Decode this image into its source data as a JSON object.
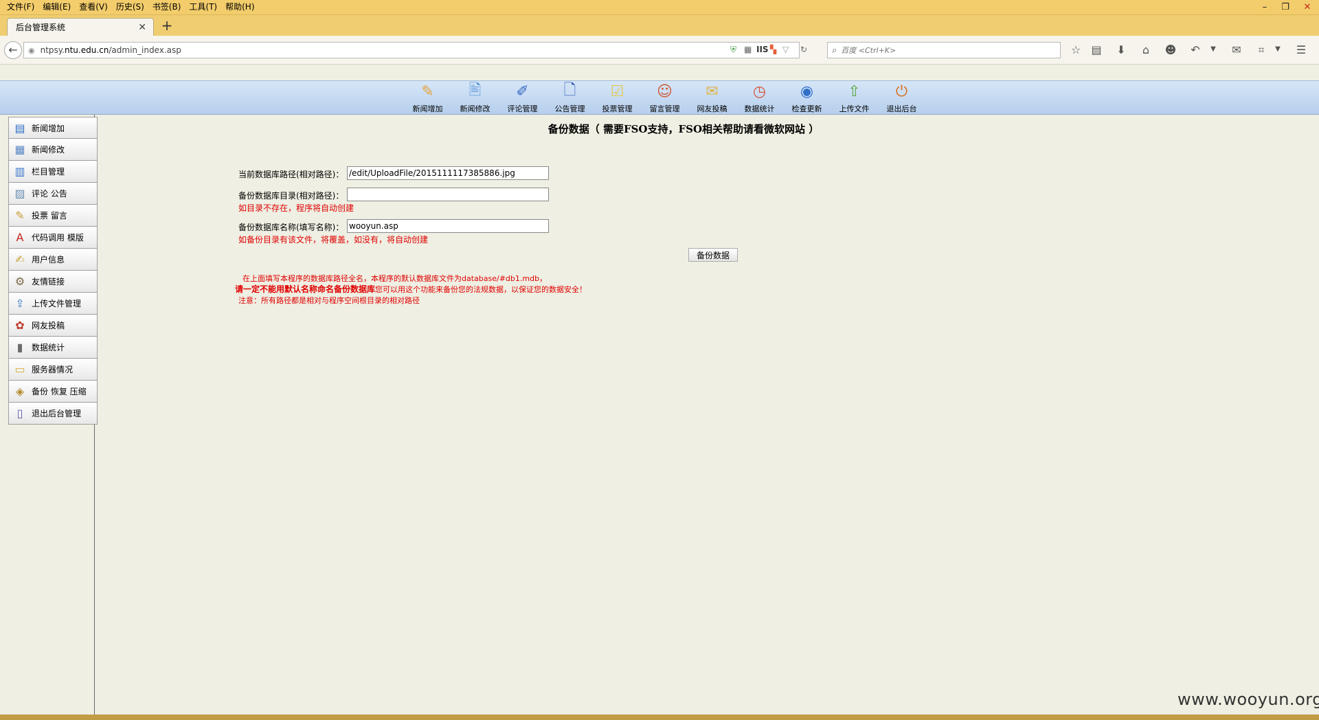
{
  "browser": {
    "menu": [
      "文件(F)",
      "编辑(E)",
      "查看(V)",
      "历史(S)",
      "书签(B)",
      "工具(T)",
      "帮助(H)"
    ],
    "tab_title": "后台管理系统",
    "url_prefix": "ntpsy.",
    "url_domain": "ntu.edu.cn",
    "url_path": "/admin_index.asp",
    "url_badge": "IIS",
    "search_placeholder": "百度 <Ctrl+K>"
  },
  "topnav": {
    "items": [
      {
        "label": "新闻增加",
        "icon": "news-add-icon",
        "glyph": "✎",
        "color": "#e9a23b"
      },
      {
        "label": "新闻修改",
        "icon": "news-edit-icon",
        "glyph": "🖹",
        "color": "#4b8fd6"
      },
      {
        "label": "评论管理",
        "icon": "comment-manage-icon",
        "glyph": "✐",
        "color": "#3566c2"
      },
      {
        "label": "公告管理",
        "icon": "notice-manage-icon",
        "glyph": "🗋",
        "color": "#2f58b5"
      },
      {
        "label": "投票管理",
        "icon": "vote-manage-icon",
        "glyph": "☑",
        "color": "#e6c74c"
      },
      {
        "label": "留言管理",
        "icon": "message-manage-icon",
        "glyph": "☺",
        "color": "#d05a32"
      },
      {
        "label": "网友投稿",
        "icon": "submit-article-icon",
        "glyph": "✉",
        "color": "#e0b449"
      },
      {
        "label": "数据统计",
        "icon": "statistics-icon",
        "glyph": "◷",
        "color": "#d6543a"
      },
      {
        "label": "检查更新",
        "icon": "check-update-icon",
        "glyph": "◉",
        "color": "#2f6fc8"
      },
      {
        "label": "上传文件",
        "icon": "upload-file-icon",
        "glyph": "⇧",
        "color": "#5aa83a"
      },
      {
        "label": "退出后台",
        "icon": "exit-icon",
        "glyph": "⏻",
        "color": "#d8721e"
      }
    ]
  },
  "sidebar": {
    "items": [
      {
        "label": "新闻增加",
        "icon": "news-add-icon",
        "glyph": "▤",
        "color": "#2e6fc7"
      },
      {
        "label": "新闻修改",
        "icon": "news-edit-icon",
        "glyph": "▦",
        "color": "#5a86c5"
      },
      {
        "label": "栏目管理",
        "icon": "column-manage-icon",
        "glyph": "▥",
        "color": "#3a78c9"
      },
      {
        "label": "评论 公告",
        "icon": "comment-notice-icon",
        "glyph": "▨",
        "color": "#6d8fb5"
      },
      {
        "label": "投票 留言",
        "icon": "vote-message-icon",
        "glyph": "✎",
        "color": "#c89b35"
      },
      {
        "label": "代码调用 模版",
        "icon": "code-template-icon",
        "glyph": "A",
        "color": "#c2271c"
      },
      {
        "label": "用户信息",
        "icon": "user-info-icon",
        "glyph": "✍",
        "color": "#c9a53a"
      },
      {
        "label": "友情链接",
        "icon": "friend-link-icon",
        "glyph": "⚙",
        "color": "#7a6a4a"
      },
      {
        "label": "上传文件管理",
        "icon": "upload-manage-icon",
        "glyph": "⇪",
        "color": "#3c7fc2"
      },
      {
        "label": "网友投稿",
        "icon": "submit-article-icon",
        "glyph": "✿",
        "color": "#c0392b"
      },
      {
        "label": "数据统计",
        "icon": "statistics-icon",
        "glyph": "▮",
        "color": "#6b6b6b"
      },
      {
        "label": "服务器情况",
        "icon": "server-status-icon",
        "glyph": "▭",
        "color": "#d6b13c"
      },
      {
        "label": "备份 恢复 压缩",
        "icon": "backup-icon",
        "glyph": "◈",
        "color": "#b38a2e"
      },
      {
        "label": "退出后台管理",
        "icon": "logout-icon",
        "glyph": "▯",
        "color": "#5a5aa8"
      }
    ]
  },
  "form": {
    "title": "备份数据（ 需要FSO支持，FSO相关帮助请看微软网站 ）",
    "current_path_label": "当前数据库路径(相对路径)：",
    "current_path_value": "/edit/UploadFile/2015111117385886.jpg",
    "backup_dir_label": "备份数据库目录(相对路径)：",
    "backup_dir_value": "",
    "backup_dir_hint": "如目录不存在，程序将自动创建",
    "backup_name_label": "备份数据库名称(填写名称)：",
    "backup_name_value": "wooyun.asp",
    "backup_name_hint": "如备份目录有该文件，将覆盖，如没有，将自动创建",
    "backup_button": "备份数据",
    "note1": "在上面填写本程序的数据库路径全名，本程序的默认数据库文件为database/#db1.mdb，",
    "note2_bold": "请一定不能用默认名称命名备份数据库",
    "note2_rest": "您可以用这个功能来备份您的法规数据，以保证您的数据安全！",
    "note3": "注意：所有路径都是相对与程序空间根目录的相对路径"
  },
  "watermark": "www.wooyun.org"
}
